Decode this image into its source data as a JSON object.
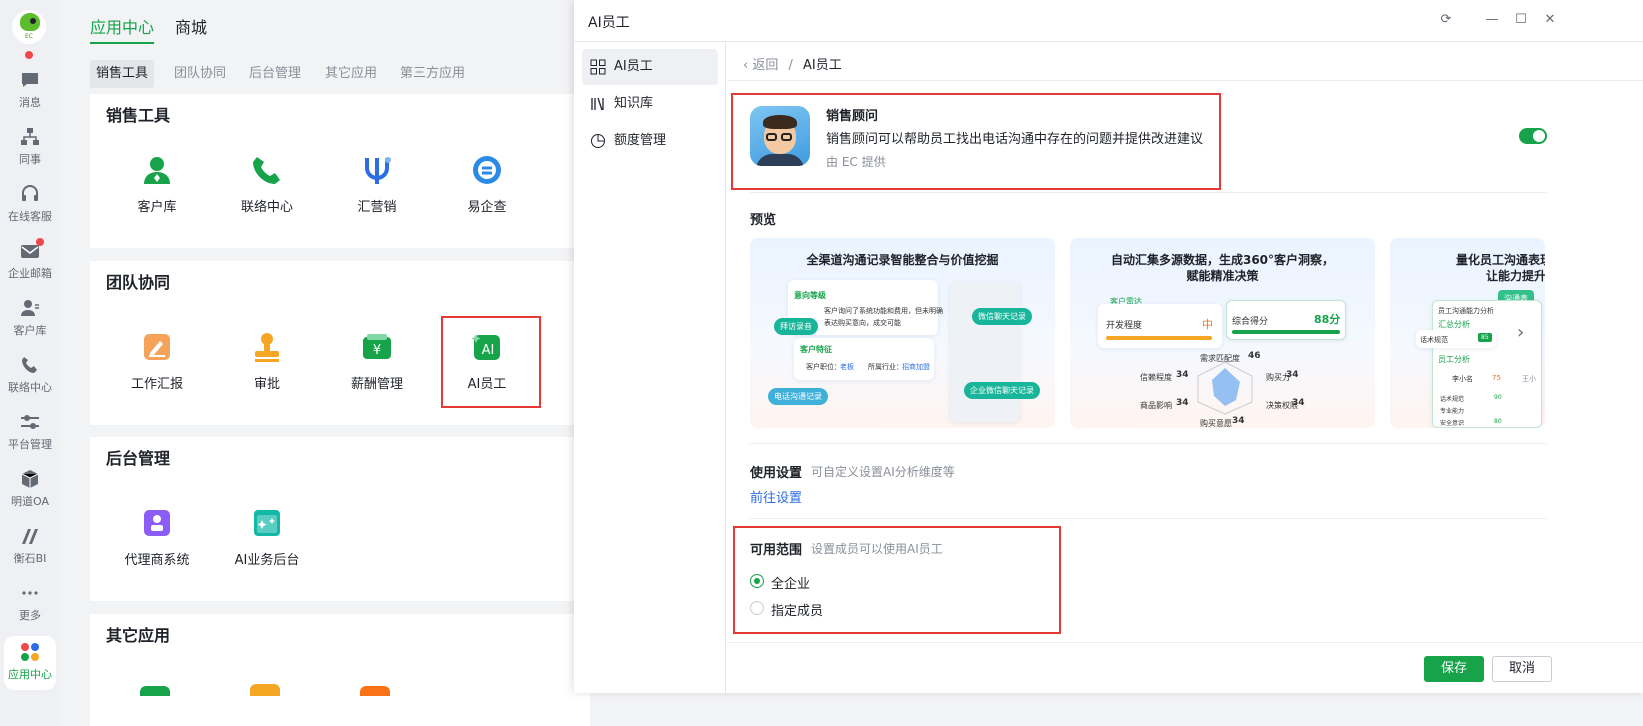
{
  "rail": {
    "logo_text": "EC",
    "items": [
      {
        "label": "消息",
        "icon": "chat-icon"
      },
      {
        "label": "同事",
        "icon": "org-icon"
      },
      {
        "label": "在线客服",
        "icon": "headset-icon"
      },
      {
        "label": "企业邮箱",
        "icon": "mail-icon"
      },
      {
        "label": "客户库",
        "icon": "customer-icon"
      },
      {
        "label": "联络中心",
        "icon": "phone-icon"
      },
      {
        "label": "平台管理",
        "icon": "sliders-icon"
      },
      {
        "label": "明道OA",
        "icon": "cube-icon"
      },
      {
        "label": "衡石BI",
        "icon": "bi-icon"
      },
      {
        "label": "更多",
        "icon": "more-icon"
      },
      {
        "label": "应用中心",
        "icon": "apps-icon"
      }
    ]
  },
  "main": {
    "top_tabs": [
      "应用中心",
      "商城"
    ],
    "sub_tabs": [
      "销售工具",
      "团队协同",
      "后台管理",
      "其它应用",
      "第三方应用"
    ],
    "sections": [
      {
        "title": "销售工具",
        "apps": [
          "客户库",
          "联络中心",
          "汇营销",
          "易企查"
        ]
      },
      {
        "title": "团队协同",
        "apps": [
          "工作汇报",
          "审批",
          "薪酬管理",
          "AI员工"
        ]
      },
      {
        "title": "后台管理",
        "apps": [
          "代理商系统",
          "AI业务后台"
        ]
      },
      {
        "title": "其它应用",
        "apps": []
      }
    ]
  },
  "drawer": {
    "title": "AI员工",
    "nav": [
      "AI员工",
      "知识库",
      "额度管理"
    ],
    "breadcrumb": {
      "back": "返回",
      "sep": "/",
      "current": "AI员工"
    },
    "agent": {
      "name": "销售顾问",
      "description": "销售顾问可以帮助员工找出电话沟通中存在的问题并提供改进建议",
      "provider": "由 EC 提供",
      "enabled": true
    },
    "preview": {
      "title": "预览",
      "cards": [
        {
          "title": "全渠道沟通记录智能整合与价值挖掘",
          "labels": {
            "intent": "意向等级",
            "intent_text1": "客户询问了系统功能和费用，但未明确",
            "intent_text2": "表达购买意向，成交可能",
            "visit": "拜访录音",
            "wechat": "微信聊天记录",
            "feature": "客户特征",
            "position": "客户职位：",
            "position_val": "老板",
            "industry": "所属行业：",
            "industry_val": "招商加盟",
            "ewechat": "企业微信聊天记录",
            "call": "电话沟通记录"
          }
        },
        {
          "title": "自动汇集多源数据，生成360°客户洞察，",
          "title2": "赋能精准决策",
          "labels": {
            "radar": "客户雷达",
            "develop": "开发程度",
            "develop_val": "中",
            "score": "综合得分",
            "score_val": "88分",
            "m1": "需求匹配度",
            "m1v": "46",
            "m2": "信赖程度",
            "m2v": "34",
            "m3": "购买力",
            "m3v": "34",
            "m4": "商品影响",
            "m4v": "34",
            "m5": "决策权限",
            "m5v": "34",
            "m6": "购买意愿",
            "m6v": "34"
          }
        },
        {
          "title": "量化员工沟通表现",
          "title2": "让能力提升",
          "labels": {
            "pill": "沟通表",
            "h1": "员工沟通能力分析",
            "h2": "汇总分析",
            "r1": "话术规范",
            "r1v": "85",
            "h3": "员工分析",
            "p1": "李小名",
            "p1v": "75",
            "p2": "王小",
            "l1": "话术规范",
            "l1v": "90",
            "l2": "专业能力",
            "l3": "安全意识",
            "l3v": "80"
          }
        }
      ]
    },
    "usage": {
      "title": "使用设置",
      "desc": "可自定义设置AI分析维度等",
      "link": "前往设置"
    },
    "scope": {
      "title": "可用范围",
      "desc": "设置成员可以使用AI员工",
      "options": [
        {
          "label": "全企业",
          "selected": true
        },
        {
          "label": "指定成员",
          "selected": false
        }
      ]
    },
    "buttons": {
      "save": "保存",
      "cancel": "取消"
    }
  },
  "colors": {
    "accent": "#16a34a",
    "highlight": "#e53935",
    "link": "#2b6de5"
  }
}
